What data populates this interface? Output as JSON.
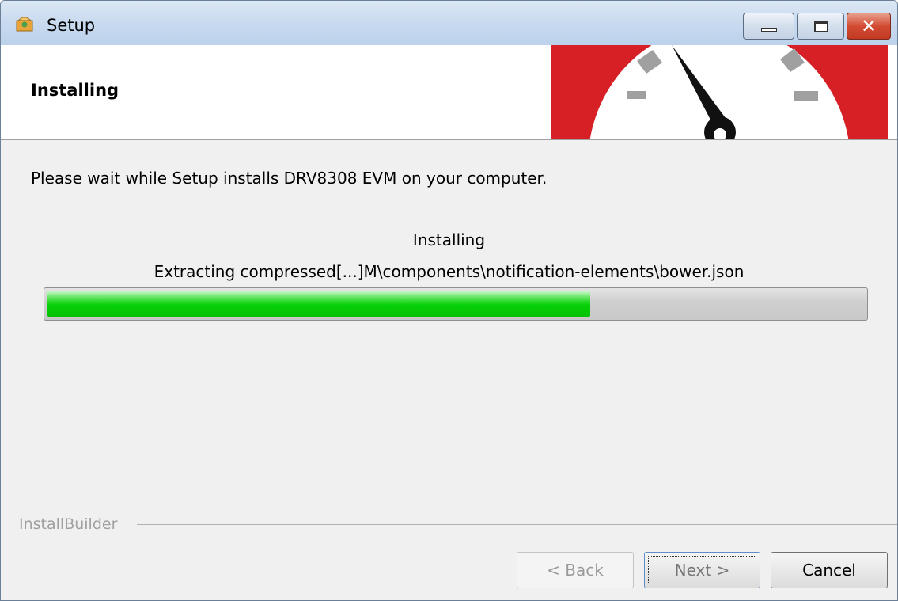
{
  "window": {
    "title": "Setup",
    "controls": {
      "minimize": "minimize",
      "maximize": "maximize",
      "close": "✕"
    }
  },
  "header": {
    "title": "Installing"
  },
  "body": {
    "intro": "Please wait while Setup installs DRV8308 EVM on your computer.",
    "status_title": "Installing",
    "status_detail": "Extracting compressed[...]M\\components\\notification-elements\\bower.json",
    "progress_fraction": 0.665
  },
  "footer": {
    "brand": "InstallBuilder",
    "back_label": "< Back",
    "next_label": "Next >",
    "cancel_label": "Cancel"
  },
  "colors": {
    "progress": "#06d006",
    "header_graphic_red": "#d71f26"
  }
}
